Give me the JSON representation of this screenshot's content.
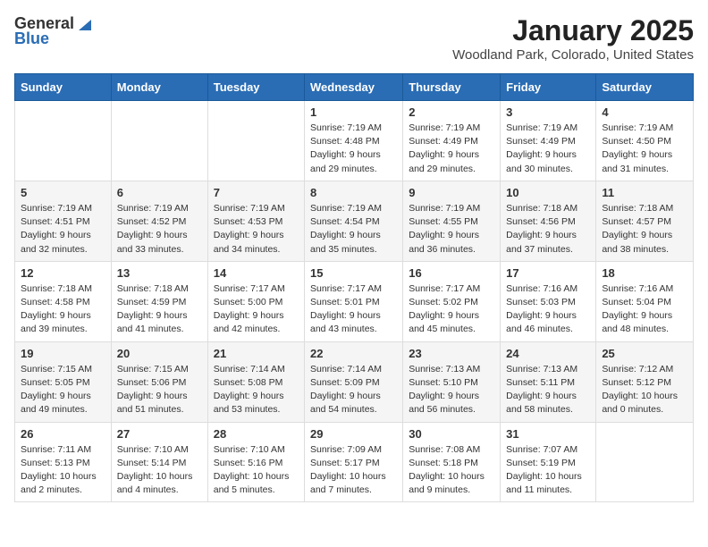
{
  "header": {
    "logo_general": "General",
    "logo_blue": "Blue",
    "title": "January 2025",
    "subtitle": "Woodland Park, Colorado, United States"
  },
  "weekdays": [
    "Sunday",
    "Monday",
    "Tuesday",
    "Wednesday",
    "Thursday",
    "Friday",
    "Saturday"
  ],
  "weeks": [
    [
      {
        "day": "",
        "info": ""
      },
      {
        "day": "",
        "info": ""
      },
      {
        "day": "",
        "info": ""
      },
      {
        "day": "1",
        "info": "Sunrise: 7:19 AM\nSunset: 4:48 PM\nDaylight: 9 hours and 29 minutes."
      },
      {
        "day": "2",
        "info": "Sunrise: 7:19 AM\nSunset: 4:49 PM\nDaylight: 9 hours and 29 minutes."
      },
      {
        "day": "3",
        "info": "Sunrise: 7:19 AM\nSunset: 4:49 PM\nDaylight: 9 hours and 30 minutes."
      },
      {
        "day": "4",
        "info": "Sunrise: 7:19 AM\nSunset: 4:50 PM\nDaylight: 9 hours and 31 minutes."
      }
    ],
    [
      {
        "day": "5",
        "info": "Sunrise: 7:19 AM\nSunset: 4:51 PM\nDaylight: 9 hours and 32 minutes."
      },
      {
        "day": "6",
        "info": "Sunrise: 7:19 AM\nSunset: 4:52 PM\nDaylight: 9 hours and 33 minutes."
      },
      {
        "day": "7",
        "info": "Sunrise: 7:19 AM\nSunset: 4:53 PM\nDaylight: 9 hours and 34 minutes."
      },
      {
        "day": "8",
        "info": "Sunrise: 7:19 AM\nSunset: 4:54 PM\nDaylight: 9 hours and 35 minutes."
      },
      {
        "day": "9",
        "info": "Sunrise: 7:19 AM\nSunset: 4:55 PM\nDaylight: 9 hours and 36 minutes."
      },
      {
        "day": "10",
        "info": "Sunrise: 7:18 AM\nSunset: 4:56 PM\nDaylight: 9 hours and 37 minutes."
      },
      {
        "day": "11",
        "info": "Sunrise: 7:18 AM\nSunset: 4:57 PM\nDaylight: 9 hours and 38 minutes."
      }
    ],
    [
      {
        "day": "12",
        "info": "Sunrise: 7:18 AM\nSunset: 4:58 PM\nDaylight: 9 hours and 39 minutes."
      },
      {
        "day": "13",
        "info": "Sunrise: 7:18 AM\nSunset: 4:59 PM\nDaylight: 9 hours and 41 minutes."
      },
      {
        "day": "14",
        "info": "Sunrise: 7:17 AM\nSunset: 5:00 PM\nDaylight: 9 hours and 42 minutes."
      },
      {
        "day": "15",
        "info": "Sunrise: 7:17 AM\nSunset: 5:01 PM\nDaylight: 9 hours and 43 minutes."
      },
      {
        "day": "16",
        "info": "Sunrise: 7:17 AM\nSunset: 5:02 PM\nDaylight: 9 hours and 45 minutes."
      },
      {
        "day": "17",
        "info": "Sunrise: 7:16 AM\nSunset: 5:03 PM\nDaylight: 9 hours and 46 minutes."
      },
      {
        "day": "18",
        "info": "Sunrise: 7:16 AM\nSunset: 5:04 PM\nDaylight: 9 hours and 48 minutes."
      }
    ],
    [
      {
        "day": "19",
        "info": "Sunrise: 7:15 AM\nSunset: 5:05 PM\nDaylight: 9 hours and 49 minutes."
      },
      {
        "day": "20",
        "info": "Sunrise: 7:15 AM\nSunset: 5:06 PM\nDaylight: 9 hours and 51 minutes."
      },
      {
        "day": "21",
        "info": "Sunrise: 7:14 AM\nSunset: 5:08 PM\nDaylight: 9 hours and 53 minutes."
      },
      {
        "day": "22",
        "info": "Sunrise: 7:14 AM\nSunset: 5:09 PM\nDaylight: 9 hours and 54 minutes."
      },
      {
        "day": "23",
        "info": "Sunrise: 7:13 AM\nSunset: 5:10 PM\nDaylight: 9 hours and 56 minutes."
      },
      {
        "day": "24",
        "info": "Sunrise: 7:13 AM\nSunset: 5:11 PM\nDaylight: 9 hours and 58 minutes."
      },
      {
        "day": "25",
        "info": "Sunrise: 7:12 AM\nSunset: 5:12 PM\nDaylight: 10 hours and 0 minutes."
      }
    ],
    [
      {
        "day": "26",
        "info": "Sunrise: 7:11 AM\nSunset: 5:13 PM\nDaylight: 10 hours and 2 minutes."
      },
      {
        "day": "27",
        "info": "Sunrise: 7:10 AM\nSunset: 5:14 PM\nDaylight: 10 hours and 4 minutes."
      },
      {
        "day": "28",
        "info": "Sunrise: 7:10 AM\nSunset: 5:16 PM\nDaylight: 10 hours and 5 minutes."
      },
      {
        "day": "29",
        "info": "Sunrise: 7:09 AM\nSunset: 5:17 PM\nDaylight: 10 hours and 7 minutes."
      },
      {
        "day": "30",
        "info": "Sunrise: 7:08 AM\nSunset: 5:18 PM\nDaylight: 10 hours and 9 minutes."
      },
      {
        "day": "31",
        "info": "Sunrise: 7:07 AM\nSunset: 5:19 PM\nDaylight: 10 hours and 11 minutes."
      },
      {
        "day": "",
        "info": ""
      }
    ]
  ]
}
